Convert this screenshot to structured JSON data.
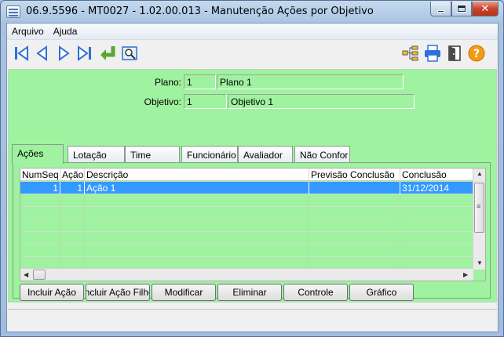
{
  "window": {
    "title": "06.9.5596 - MT0027 - 1.02.00.013 - Manutenção Ações por Objetivo",
    "min_label": "",
    "close_label": "✕"
  },
  "menubar": {
    "items": [
      {
        "label": "Arquivo"
      },
      {
        "label": "Ajuda"
      }
    ]
  },
  "toolbar": {
    "icons": [
      "first-record-icon",
      "previous-record-icon",
      "next-record-icon",
      "last-record-icon",
      "return-icon",
      "zoom-icon",
      "hierarchy-icon",
      "print-icon",
      "exit-door-icon",
      "help-icon"
    ]
  },
  "form": {
    "plano_label": "Plano:",
    "plano_code": "1",
    "plano_desc": "Plano 1",
    "objetivo_label": "Objetivo:",
    "objetivo_code": "1",
    "objetivo_desc": "Objetivo 1"
  },
  "tabs": [
    {
      "label": "Ações",
      "active": true
    },
    {
      "label": "Lotação"
    },
    {
      "label": "Time"
    },
    {
      "label": "Funcionário"
    },
    {
      "label": "Avaliador"
    },
    {
      "label": "Não Confor"
    }
  ],
  "grid": {
    "columns": [
      "NumSeq",
      "Ação",
      "Descrição",
      "Previsão Conclusão",
      "Conclusão"
    ],
    "rows": [
      {
        "numseq": "1",
        "acao": "1",
        "descricao": "Ação 1",
        "previsao": "",
        "conclusao": "31/12/2014",
        "selected": true
      }
    ]
  },
  "buttons": [
    {
      "label": "Incluir Ação"
    },
    {
      "label": "Incluir Ação Filho"
    },
    {
      "label": "Modificar"
    },
    {
      "label": "Eliminar"
    },
    {
      "label": "Controle"
    },
    {
      "label": "Gráfico"
    }
  ],
  "colors": {
    "form_bg": "#9ff29f",
    "selection": "#3399ff",
    "nav_blue": "#2f6fd6",
    "return_green": "#5aa631",
    "help_orange": "#f39c12"
  }
}
